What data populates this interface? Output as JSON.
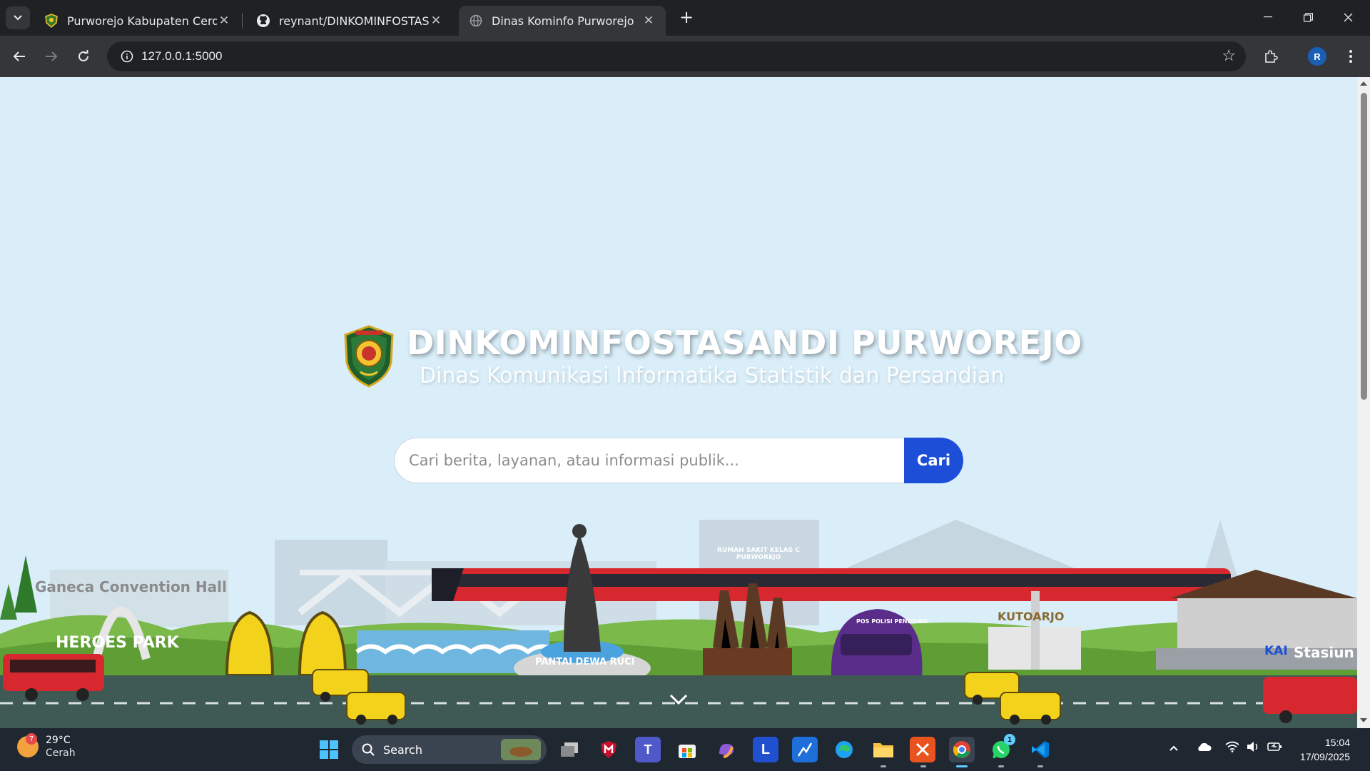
{
  "browser": {
    "tabs": [
      {
        "title": "Purworejo Kabupaten Cerdas",
        "favicon": "crest-icon",
        "active": false
      },
      {
        "title": "reynant/DINKOMINFOSTASANDI",
        "favicon": "github-icon",
        "active": false
      },
      {
        "title": "Dinas Kominfo Purworejo",
        "favicon": "globe-icon",
        "active": true
      }
    ],
    "url": "127.0.0.1:5000",
    "profile_initial": "R"
  },
  "hero": {
    "title": "DINKOMINFOSTASANDI PURWOREJO",
    "subtitle": "Dinas Komunikasi Informatika Statistik dan Persandian"
  },
  "search": {
    "placeholder": "Cari berita, layanan, atau informasi publik...",
    "button_label": "Cari"
  },
  "scene": {
    "labels": {
      "ganeca": "Ganeca Convention Hall",
      "heroes": "HEROES PARK",
      "pantai": "PANTAI DEWA RUCI",
      "rs": "RUMAH SAKIT KELAS C PURWOREJO",
      "pos": "POS POLISI PENDOWO",
      "kutoarjo": "KUTOARJO",
      "stasiun": "Stasiun",
      "kai": "KAI"
    }
  },
  "taskbar": {
    "weather_temp": "29°C",
    "weather_cond": "Cerah",
    "weather_badge": "7",
    "search_label": "Search",
    "time": "15:04",
    "date": "17/09/2025",
    "whatsapp_badge": "1"
  },
  "colors": {
    "sky": "#d9eef9",
    "search_button": "#1d4ed8",
    "chrome_dark": "#202124",
    "chrome_toolbar": "#35363a",
    "taskbar": "#1f2731"
  }
}
